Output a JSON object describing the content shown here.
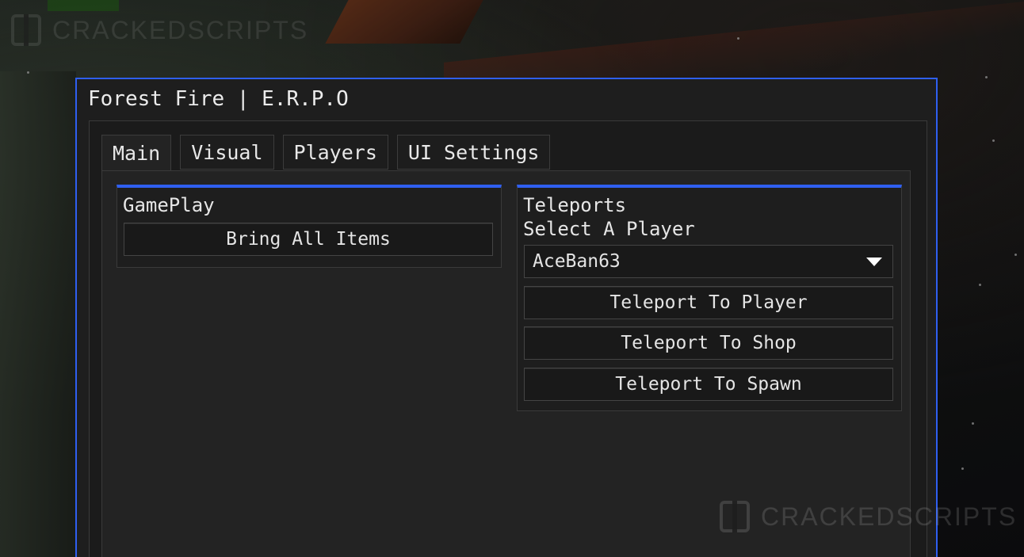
{
  "watermark": {
    "text_top": "CRACKEDSCRIPTS",
    "text_bottom": "CRACKEDSCRIPTS"
  },
  "window": {
    "title": "Forest Fire | E.R.P.O",
    "accent_color": "#2f5ff0"
  },
  "tabs": [
    {
      "label": "Main",
      "active": true
    },
    {
      "label": "Visual",
      "active": false
    },
    {
      "label": "Players",
      "active": false
    },
    {
      "label": "UI Settings",
      "active": false
    }
  ],
  "gameplay": {
    "title": "GamePlay",
    "bring_all_items_label": "Bring All Items"
  },
  "teleports": {
    "title": "Teleports",
    "select_label": "Select A Player",
    "selected_player": "AceBan63",
    "teleport_player_label": "Teleport To Player",
    "teleport_shop_label": "Teleport To Shop",
    "teleport_spawn_label": "Teleport To Spawn"
  }
}
